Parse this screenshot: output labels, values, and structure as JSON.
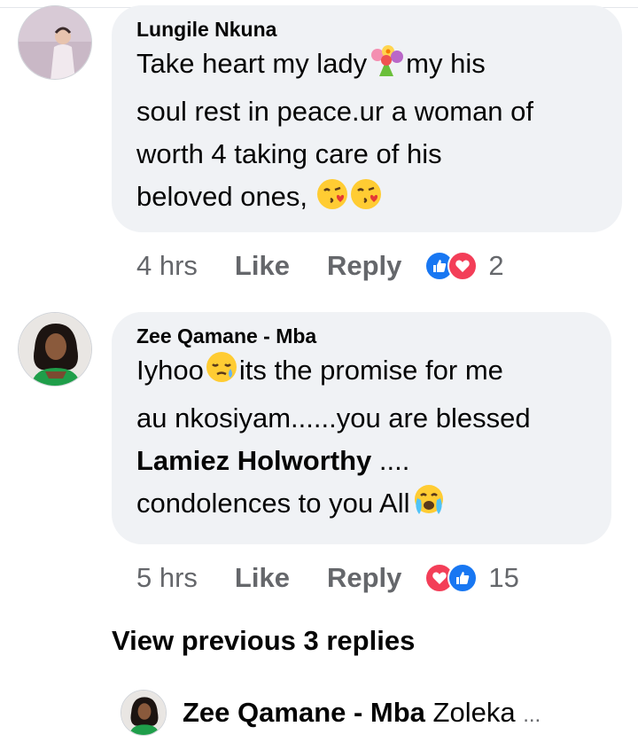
{
  "comments": [
    {
      "author": "Lungile Nkuna",
      "text_parts": {
        "p1": "Take heart my lady",
        "p2": "my his",
        "line2": "soul rest in peace.ur a woman of",
        "line3": "worth 4 taking care of his",
        "line4": "beloved ones,"
      },
      "time": "4 hrs",
      "like_label": "Like",
      "reply_label": "Reply",
      "reaction_count": "2",
      "reactions": [
        "like-icon",
        "love-icon"
      ]
    },
    {
      "author": "Zee Qamane - Mba",
      "text_parts": {
        "p1": "Iyhoo",
        "p2": "its the promise for me",
        "line2": "au nkosiyam......you are blessed",
        "mention": "Lamiez Holworthy",
        "after_mention": " ....",
        "line4": "condolences to you All"
      },
      "time": "5 hrs",
      "like_label": "Like",
      "reply_label": "Reply",
      "reaction_count": "15",
      "reactions": [
        "love-icon",
        "like-icon"
      ]
    }
  ],
  "view_previous": "View previous 3 replies",
  "reply_preview": {
    "author": "Zee Qamane - Mba",
    "text": "Zoleka",
    "ellipsis": "..."
  },
  "colors": {
    "bubble": "#f0f2f5",
    "meta_text": "#65676b",
    "like_blue": "#1877f2",
    "love_red": "#f33e58"
  }
}
